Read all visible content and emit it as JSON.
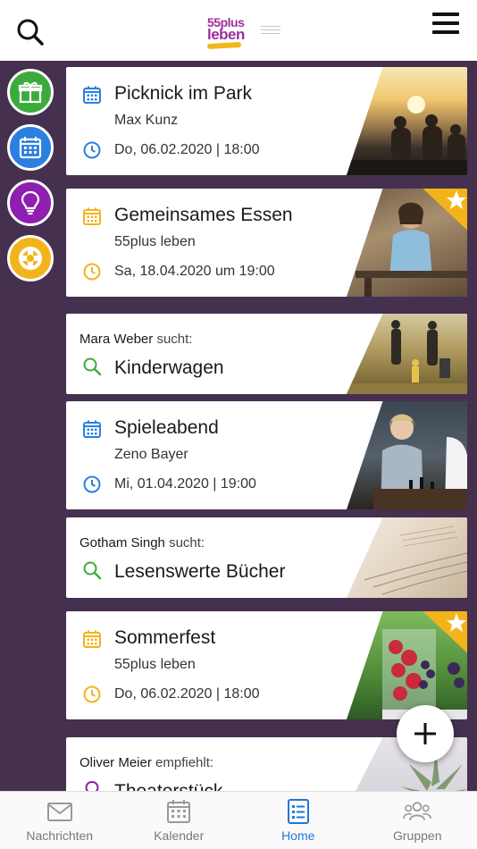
{
  "header": {
    "logo_top": "55plus",
    "logo_bottom": "leben"
  },
  "side_buttons": [
    {
      "name": "gift",
      "color": "#3cab3c"
    },
    {
      "name": "calendar",
      "color": "#2b7fe0"
    },
    {
      "name": "idea",
      "color": "#8e1fb0"
    },
    {
      "name": "help",
      "color": "#f3b41b"
    }
  ],
  "cards": [
    {
      "type": "event",
      "title": "Picknick im Park",
      "host": "Max Kunz",
      "date": "Do, 06.02.2020 | 18:00",
      "icon_color": "#2b7fe0",
      "featured": false
    },
    {
      "type": "event",
      "title": "Gemeinsames Essen",
      "host": "55plus leben",
      "date": "Sa, 18.04.2020 um 19:00",
      "icon_color": "#f3b41b",
      "featured": true
    },
    {
      "type": "search",
      "person": "Mara Weber",
      "verb": "sucht:",
      "title": "Kinderwagen",
      "icon_color": "#3cab3c"
    },
    {
      "type": "event",
      "title": "Spieleabend",
      "host": "Zeno Bayer",
      "date": "Mi, 01.04.2020 | 19:00",
      "icon_color": "#2b7fe0",
      "featured": false
    },
    {
      "type": "search",
      "person": "Gotham Singh",
      "verb": "sucht:",
      "title": "Lesenswerte Bücher",
      "icon_color": "#3cab3c"
    },
    {
      "type": "event",
      "title": "Sommerfest",
      "host": "55plus leben",
      "date": "Do, 06.02.2020 | 18:00",
      "icon_color": "#f3b41b",
      "featured": true
    },
    {
      "type": "recommend",
      "person": "Oliver Meier",
      "verb": "empfiehlt:",
      "title": "Theaterstück",
      "icon_color": "#8e1fb0"
    }
  ],
  "tabs": [
    {
      "label": "Nachrichten",
      "icon": "envelope-icon",
      "active": false
    },
    {
      "label": "Kalender",
      "icon": "calendar-icon",
      "active": false
    },
    {
      "label": "Home",
      "icon": "list-icon",
      "active": true
    },
    {
      "label": "Gruppen",
      "icon": "group-icon",
      "active": false
    }
  ],
  "colors": {
    "background": "#46304f",
    "accent": "#1f78d8",
    "star": "#f3b41b"
  }
}
